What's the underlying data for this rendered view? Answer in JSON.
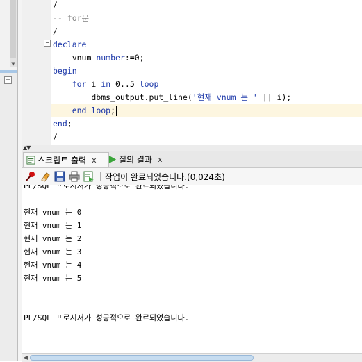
{
  "editor": {
    "lines": [
      {
        "parts": [
          {
            "t": "/",
            "c": ""
          }
        ]
      },
      {
        "parts": [
          {
            "t": "-- for문",
            "c": "cm"
          }
        ]
      },
      {
        "parts": [
          {
            "t": "/",
            "c": ""
          }
        ]
      },
      {
        "parts": [
          {
            "t": "declare",
            "c": "kw"
          }
        ]
      },
      {
        "parts": [
          {
            "t": "    vnum ",
            "c": ""
          },
          {
            "t": "number",
            "c": "kw"
          },
          {
            "t": ":=0;",
            "c": ""
          }
        ]
      },
      {
        "parts": [
          {
            "t": "begin",
            "c": "kw"
          }
        ]
      },
      {
        "parts": [
          {
            "t": "    ",
            "c": ""
          },
          {
            "t": "for",
            "c": "kw"
          },
          {
            "t": " i ",
            "c": ""
          },
          {
            "t": "in",
            "c": "kw"
          },
          {
            "t": " 0..5 ",
            "c": ""
          },
          {
            "t": "loop",
            "c": "kw"
          }
        ]
      },
      {
        "parts": [
          {
            "t": "        dbms_output.put_line(",
            "c": ""
          },
          {
            "t": "'현재 vnum 는 '",
            "c": "str"
          },
          {
            "t": " || i);",
            "c": ""
          }
        ]
      },
      {
        "parts": [
          {
            "t": "    ",
            "c": ""
          },
          {
            "t": "end loop",
            "c": "kw"
          },
          {
            "t": ";",
            "c": ""
          }
        ],
        "caret": true
      },
      {
        "parts": [
          {
            "t": "end",
            "c": "kw"
          },
          {
            "t": ";",
            "c": ""
          }
        ]
      },
      {
        "parts": [
          {
            "t": "/",
            "c": ""
          }
        ]
      }
    ]
  },
  "tabs": [
    {
      "label": "스크립트 출력",
      "close": "x",
      "icon": "script-output-icon"
    },
    {
      "label": "질의 결과",
      "close": "x",
      "icon": "run-query-icon"
    }
  ],
  "toolbar": {
    "status": "작업이 완료되었습니다.(0,024초)",
    "icons": [
      "pin-icon",
      "eraser-icon",
      "save-icon",
      "print-icon",
      "export-icon"
    ]
  },
  "output": {
    "lines": [
      "PL/SQL 프로시저가 성공적으로 완료되었습니다.",
      "",
      "현재 vnum 는 0",
      "현재 vnum 는 1",
      "현재 vnum 는 2",
      "현재 vnum 는 3",
      "현재 vnum 는 4",
      "현재 vnum 는 5",
      "",
      "",
      "PL/SQL 프로시저가 성공적으로 완료되었습니다."
    ]
  },
  "colors": {
    "keyword": "#1a36a8",
    "comment": "#808080",
    "current_line": "#fdf6e0"
  }
}
